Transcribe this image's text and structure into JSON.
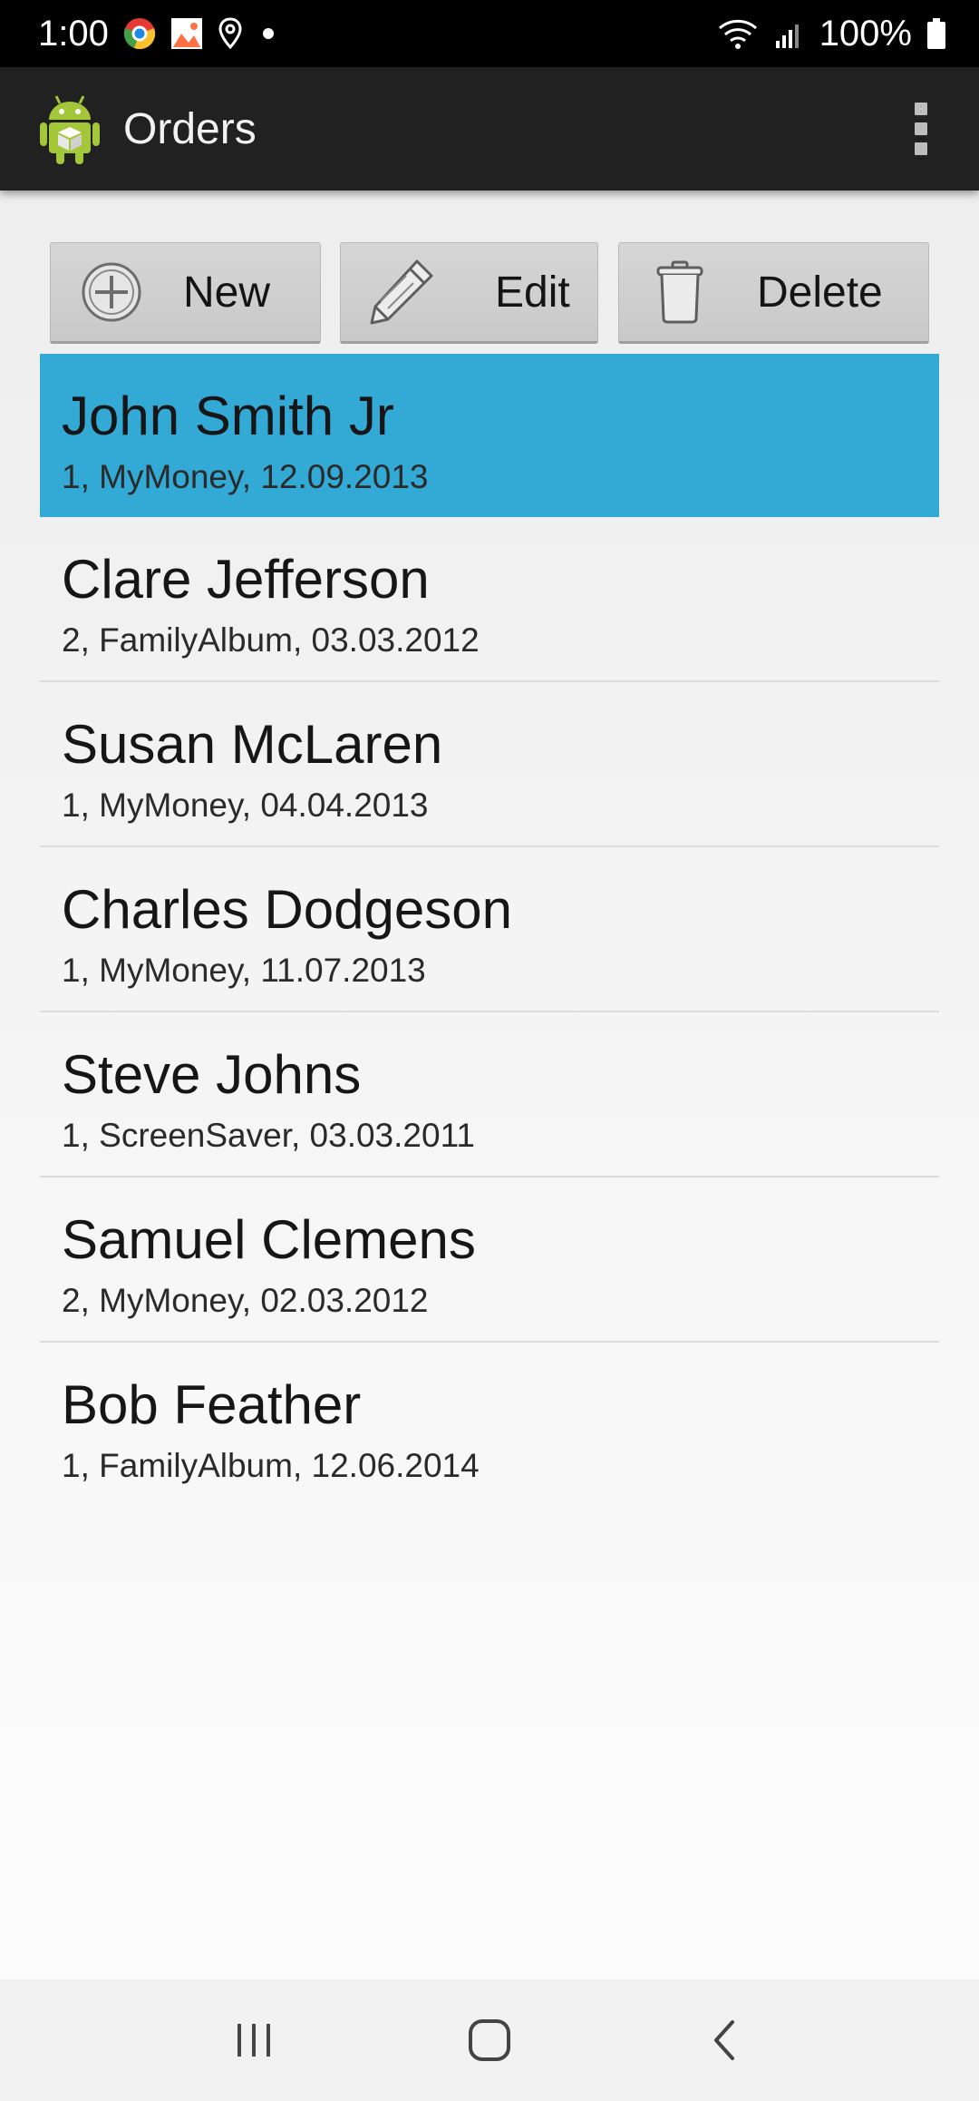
{
  "status_bar": {
    "time": "1:00",
    "battery": "100%",
    "icons": [
      "chrome-icon",
      "image-notification-icon",
      "location-icon",
      "dot-icon",
      "wifi-icon",
      "signal-icon",
      "battery-icon"
    ]
  },
  "action_bar": {
    "title": "Orders",
    "app_icon": "android-icon",
    "overflow_icon": "overflow-menu-icon"
  },
  "toolbar": {
    "new_label": "New",
    "edit_label": "Edit",
    "delete_label": "Delete"
  },
  "colors": {
    "selected_row": "#33a9d6",
    "action_bar": "#212121",
    "status_bar": "#000000"
  },
  "orders": [
    {
      "name": "John Smith Jr",
      "detail": "1, MyMoney, 12.09.2013",
      "selected": true
    },
    {
      "name": "Clare Jefferson",
      "detail": "2, FamilyAlbum, 03.03.2012",
      "selected": false
    },
    {
      "name": "Susan McLaren",
      "detail": "1, MyMoney, 04.04.2013",
      "selected": false
    },
    {
      "name": "Charles Dodgeson",
      "detail": "1, MyMoney, 11.07.2013",
      "selected": false
    },
    {
      "name": "Steve Johns",
      "detail": "1, ScreenSaver, 03.03.2011",
      "selected": false
    },
    {
      "name": "Samuel Clemens",
      "detail": "2, MyMoney, 02.03.2012",
      "selected": false
    },
    {
      "name": "Bob Feather",
      "detail": "1, FamilyAlbum, 12.06.2014",
      "selected": false
    }
  ],
  "nav_bar": {
    "icons": [
      "recent-apps-icon",
      "home-icon",
      "back-icon"
    ]
  }
}
